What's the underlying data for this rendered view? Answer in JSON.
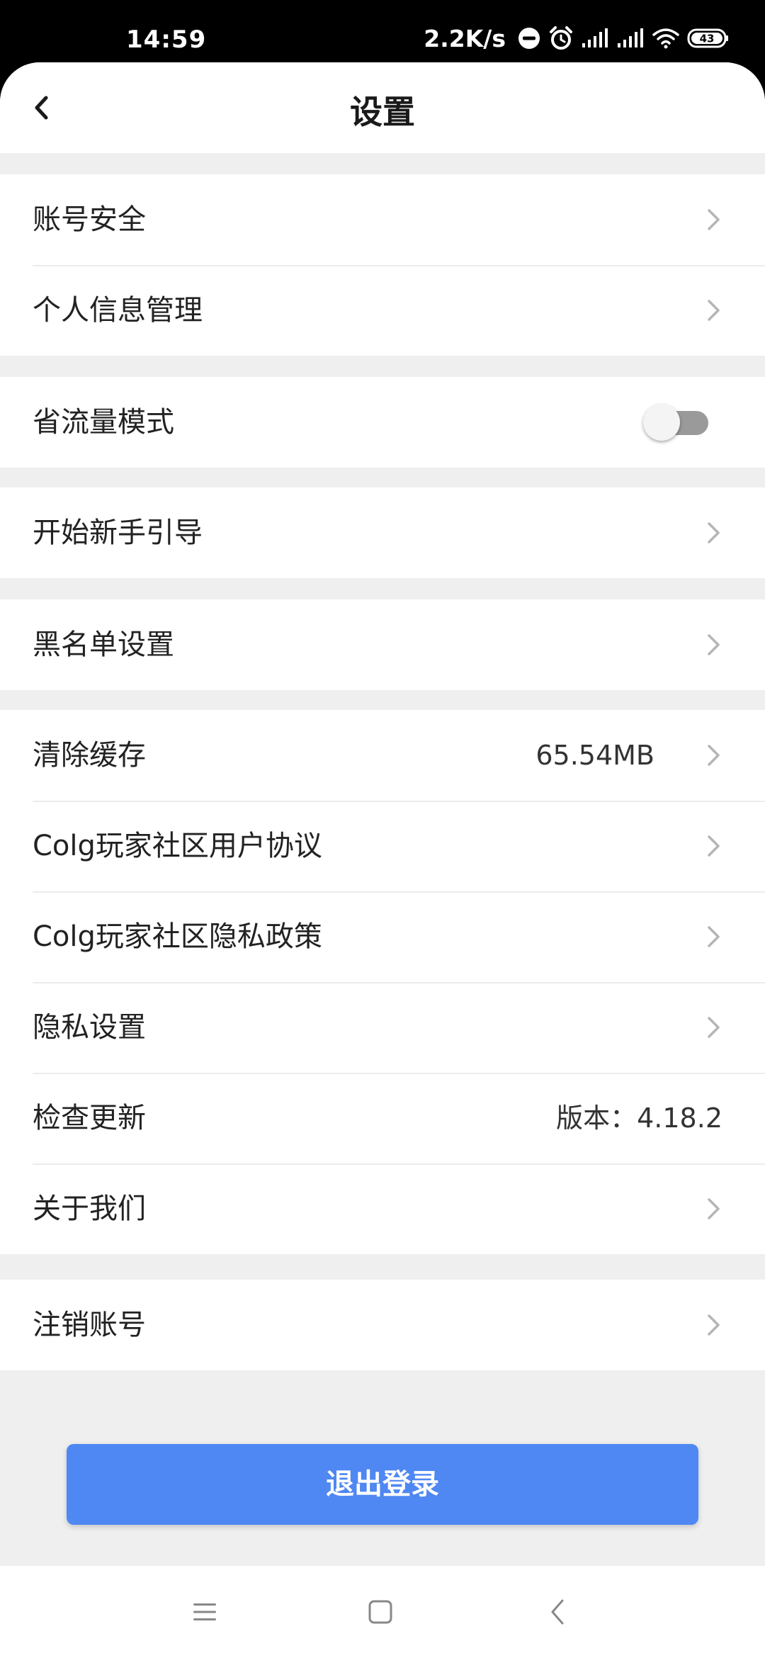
{
  "status_bar": {
    "time": "14:59",
    "network_speed": "2.2K/s",
    "battery": "43",
    "icons": [
      "do-not-disturb-icon",
      "alarm-icon",
      "signal-icon",
      "signal-icon",
      "wifi-icon",
      "battery-icon"
    ]
  },
  "header": {
    "title": "设置",
    "back_icon": "chevron-left-icon"
  },
  "sections": {
    "account": {
      "security": "账号安全",
      "personal_info": "个人信息管理"
    },
    "data_saver": {
      "label": "省流量模式",
      "enabled": false
    },
    "guide": {
      "label": "开始新手引导"
    },
    "blacklist": {
      "label": "黑名单设置"
    },
    "misc": {
      "clear_cache": "清除缓存",
      "cache_size": "65.54MB",
      "user_agreement": "Colg玩家社区用户协议",
      "privacy_policy": "Colg玩家社区隐私政策",
      "privacy_settings": "隐私设置",
      "check_update": "检查更新",
      "version": "版本：4.18.2",
      "about_us": "关于我们"
    },
    "deactivate": {
      "label": "注销账号"
    }
  },
  "logout_button": "退出登录",
  "nav_bar": {
    "icons": [
      "menu-icon",
      "home-icon",
      "back-icon"
    ]
  },
  "colors": {
    "accent": "#4f87f3",
    "background": "#efefef",
    "text": "#222222",
    "chevron": "#b5b5b5"
  }
}
